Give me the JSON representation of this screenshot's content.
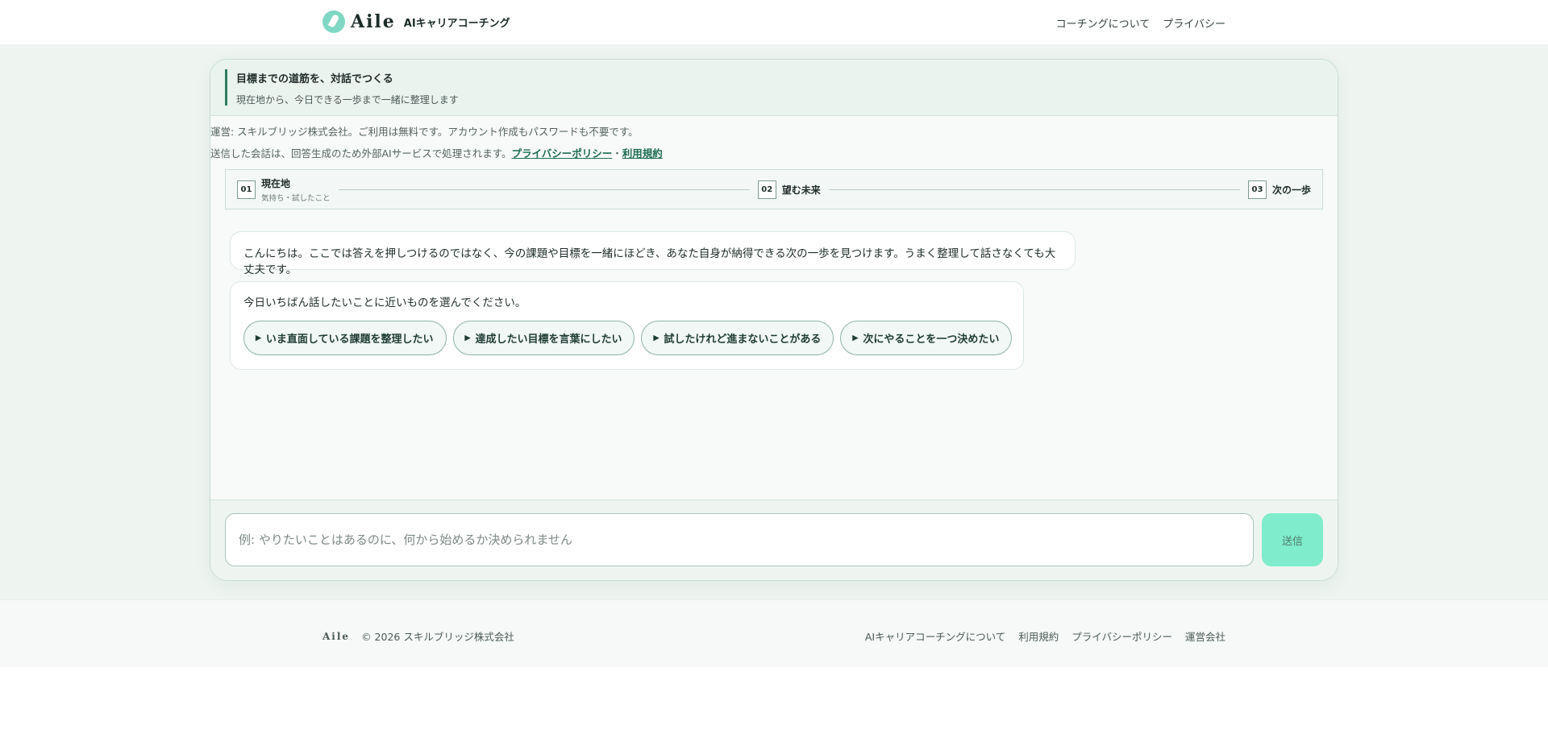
{
  "header": {
    "logo_text": "Aile",
    "logo_sub": "AIキャリアコーチング",
    "nav": [
      "コーチングについて",
      "プライバシー"
    ]
  },
  "card": {
    "title": "目標までの道筋を、対話でつくる",
    "subtitle": "現在地から、今日できる一歩まで一緒に整理します"
  },
  "notice": {
    "line1": "運営: スキルブリッジ株式会社。ご利用は無料です。アカウント作成もパスワードも不要です。",
    "line2_prefix": "送信した会話は、回答生成のため外部AIサービスで処理されます。",
    "privacy_link": "プライバシーポリシー",
    "separator": "・",
    "terms_link": "利用規約"
  },
  "steps": [
    {
      "num": "01",
      "label": "現在地",
      "sub": "気持ち・試したこと"
    },
    {
      "num": "02",
      "label": "望む未来",
      "sub": ""
    },
    {
      "num": "03",
      "label": "次の一歩",
      "sub": ""
    }
  ],
  "messages": {
    "greeting": "こんにちは。ここでは答えを押しつけるのではなく、今の課題や目標を一緒にほどき、あなた自身が納得できる次の一歩を見つけます。うまく整理して話さなくても大丈夫です。",
    "prompt": "今日いちばん話したいことに近いものを選んでください。",
    "chip_icon": "play-triangle-icon",
    "choices": [
      "いま直面している課題を整理したい",
      "達成したい目標を言葉にしたい",
      "試したけれど進まないことがある",
      "次にやることを一つ決めたい"
    ]
  },
  "composer": {
    "placeholder": "例: やりたいことはあるのに、何から始めるか決められません",
    "value": "",
    "send_label": "送信"
  },
  "footer": {
    "logo": "Aile",
    "copyright": "© 2026 スキルブリッジ株式会社",
    "links": [
      "AIキャリアコーチングについて",
      "利用規約",
      "プライバシーポリシー",
      "運営会社"
    ]
  },
  "colors": {
    "accent": "#2e7d62",
    "send_button": "#7feccb",
    "page_background": "#eef5f1"
  }
}
